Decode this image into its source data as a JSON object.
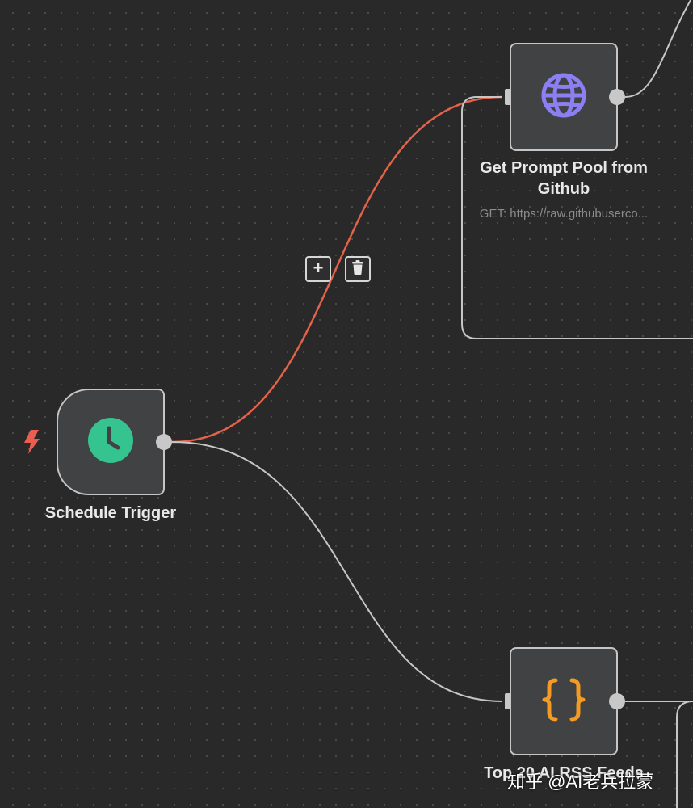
{
  "canvas": {
    "background": "#292929",
    "dot_color": "#4d4d4d"
  },
  "colors": {
    "selected_edge": "#e2624a",
    "edge": "#c6c6c6",
    "trigger_icon": "#35c38f",
    "http_icon": "#8b7ff1",
    "code_icon": "#f59a23",
    "lightning": "#ea5e4f"
  },
  "nodes": {
    "schedule_trigger": {
      "label": "Schedule Trigger",
      "icon": "clock-icon",
      "badge_icon": "lightning-icon"
    },
    "get_prompt_pool": {
      "label_line1": "Get Prompt Pool from",
      "label_line2": "Github",
      "subtitle": "GET: https://raw.githubuserco...",
      "icon": "globe-icon"
    },
    "rss_feeds": {
      "label": "Top 20 AI RSS Feeds",
      "icon": "braces-icon"
    }
  },
  "edge_toolbar": {
    "add_label": "+",
    "add_icon": "plus-icon",
    "delete_icon": "trash-icon"
  },
  "watermark": {
    "text": "知乎 @AI老兵拉蒙"
  }
}
